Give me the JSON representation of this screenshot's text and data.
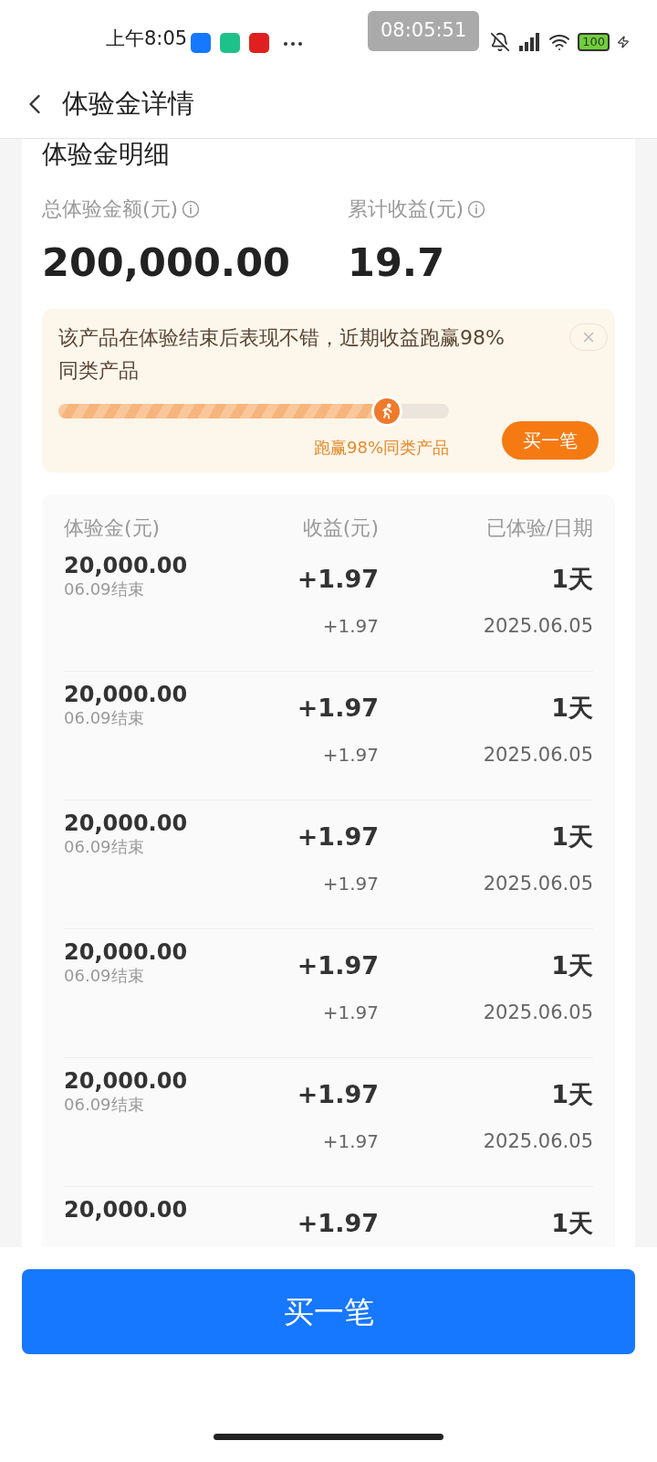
{
  "status_bar": {
    "time": "上午8:05",
    "recorder_time": "08:05:51",
    "battery": "100"
  },
  "header": {
    "title": "体验金详情"
  },
  "summary": {
    "title": "体验金明细",
    "total_label": "总体验金额(元)",
    "total_value": "200,000.00",
    "earnings_label": "累计收益(元)",
    "earnings_value": "19.7"
  },
  "promo": {
    "text": "该产品在体验结束后表现不错，近期收益跑赢98%同类产品",
    "level": 0.84,
    "progress_label": "跑赢98%同类产品",
    "button": "买一笔"
  },
  "table": {
    "columns": [
      "体验金(元)",
      "收益(元)",
      "已体验/日期"
    ],
    "rows": [
      {
        "amount": "20,000.00",
        "end": "06.09结束",
        "gain": "+1.97",
        "days": "1天",
        "sub_gain": "+1.97",
        "date": "2025.06.05"
      },
      {
        "amount": "20,000.00",
        "end": "06.09结束",
        "gain": "+1.97",
        "days": "1天",
        "sub_gain": "+1.97",
        "date": "2025.06.05"
      },
      {
        "amount": "20,000.00",
        "end": "06.09结束",
        "gain": "+1.97",
        "days": "1天",
        "sub_gain": "+1.97",
        "date": "2025.06.05"
      },
      {
        "amount": "20,000.00",
        "end": "06.09结束",
        "gain": "+1.97",
        "days": "1天",
        "sub_gain": "+1.97",
        "date": "2025.06.05"
      },
      {
        "amount": "20,000.00",
        "end": "06.09结束",
        "gain": "+1.97",
        "days": "1天",
        "sub_gain": "+1.97",
        "date": "2025.06.05"
      },
      {
        "amount": "20,000.00",
        "gain": "+1.97",
        "days": "1天"
      }
    ]
  },
  "buy_button": "买一笔"
}
